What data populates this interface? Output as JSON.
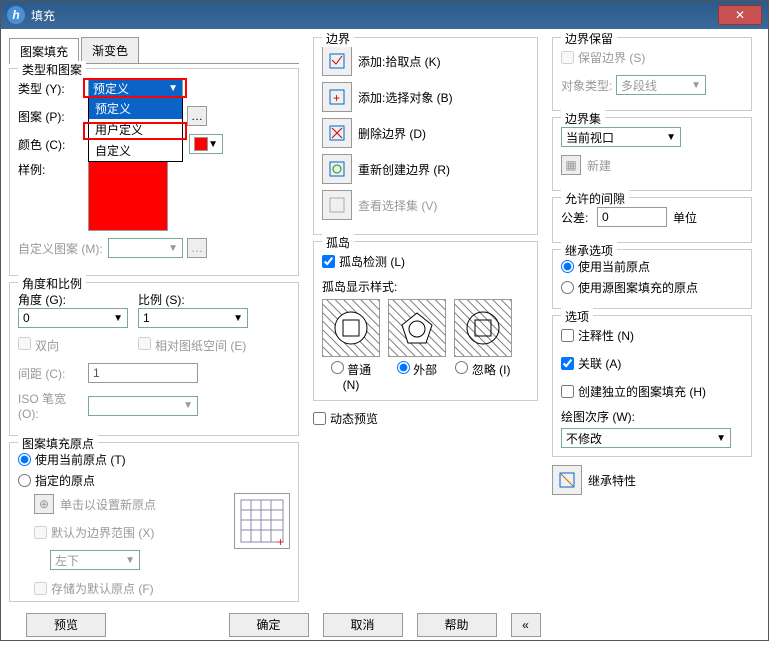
{
  "title": "填充",
  "tabs": {
    "pattern": "图案填充",
    "gradient": "渐变色"
  },
  "typeGroup": {
    "title": "类型和图案",
    "typeLabel": "类型 (Y):",
    "typeValue": "预定义",
    "typeOptions": [
      "预定义",
      "用户定义",
      "自定义"
    ],
    "patternLabel": "图案 (P):",
    "colorLabel": "颜色 (C):",
    "colorValue": "红",
    "sampleLabel": "样例:",
    "customLabel": "自定义图案 (M):"
  },
  "angleGroup": {
    "title": "角度和比例",
    "angleLabel": "角度 (G):",
    "angleValue": "0",
    "scaleLabel": "比例 (S):",
    "scaleValue": "1",
    "double": "双向",
    "paperspace": "相对图纸空间 (E)",
    "spacingLabel": "间距 (C):",
    "spacingValue": "1",
    "isoLabel": "ISO 笔宽 (O):"
  },
  "originGroup": {
    "title": "图案填充原点",
    "useCurrent": "使用当前原点 (T)",
    "specified": "指定的原点",
    "clickSet": "单击以设置新原点",
    "defaultBoundary": "默认为边界范围 (X)",
    "position": "左下",
    "storeDefault": "存储为默认原点 (F)"
  },
  "boundary": {
    "title": "边界",
    "addPick": "添加:拾取点 (K)",
    "addSelect": "添加:选择对象 (B)",
    "remove": "删除边界 (D)",
    "recreate": "重新创建边界 (R)",
    "view": "查看选择集 (V)"
  },
  "islands": {
    "title": "孤岛",
    "detection": "孤岛检测 (L)",
    "styleLabel": "孤岛显示样式:",
    "normal": "普通 (N)",
    "outer": "外部",
    "ignore": "忽略 (I)"
  },
  "dynPreview": "动态预览",
  "retain": {
    "title": "边界保留",
    "keep": "保留边界 (S)",
    "objTypeLabel": "对象类型:",
    "objTypeValue": "多段线"
  },
  "bset": {
    "title": "边界集",
    "value": "当前视口",
    "new": "新建"
  },
  "gap": {
    "title": "允许的间隙",
    "tolLabel": "公差:",
    "tolValue": "0",
    "unit": "单位"
  },
  "inherit": {
    "title": "继承选项",
    "current": "使用当前原点",
    "source": "使用源图案填充的原点"
  },
  "options": {
    "title": "选项",
    "annotative": "注释性 (N)",
    "associative": "关联 (A)",
    "separate": "创建独立的图案填充 (H)",
    "drawOrderLabel": "绘图次序 (W):",
    "drawOrderValue": "不修改"
  },
  "inheritProps": "继承特性",
  "buttons": {
    "preview": "预览",
    "ok": "确定",
    "cancel": "取消",
    "help": "帮助"
  }
}
